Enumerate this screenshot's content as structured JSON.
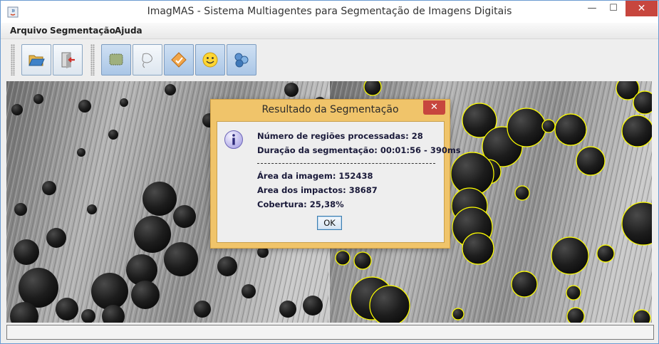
{
  "window": {
    "title": "ImagMAS - Sistema Multiagentes para Segmentação de Imagens Digitais",
    "minimize_glyph": "—",
    "maximize_glyph": "☐",
    "close_glyph": "✕"
  },
  "menu": {
    "items": [
      "Arquivo",
      "Segmentação",
      "Ajuda"
    ]
  },
  "toolbar": {
    "buttons": [
      {
        "icon": "open-folder-icon",
        "active": false
      },
      {
        "icon": "exit-icon",
        "active": false
      },
      {
        "icon": "region-select-icon",
        "active": true
      },
      {
        "icon": "freeform-lasso-icon",
        "active": false
      },
      {
        "icon": "diamond-tool-icon",
        "active": true
      },
      {
        "icon": "smiley-agent-icon",
        "active": true
      },
      {
        "icon": "agents-cluster-icon",
        "active": true
      }
    ]
  },
  "dialog": {
    "title": "Resultado da Segmentação",
    "close_glyph": "✕",
    "icon": "info-icon",
    "lines": [
      "Número de regiões processadas: 28",
      "Duração da segmentação: 00:01:56 - 390ms",
      "Área da imagem: 152438",
      "Area dos impactos: 38687",
      "Cobertura: 25,38%"
    ],
    "ok_label": "OK"
  },
  "colors": {
    "dialog_frame": "#f0c46a",
    "segmentation_outline": "#ffff00",
    "close_button": "#c7463e"
  }
}
